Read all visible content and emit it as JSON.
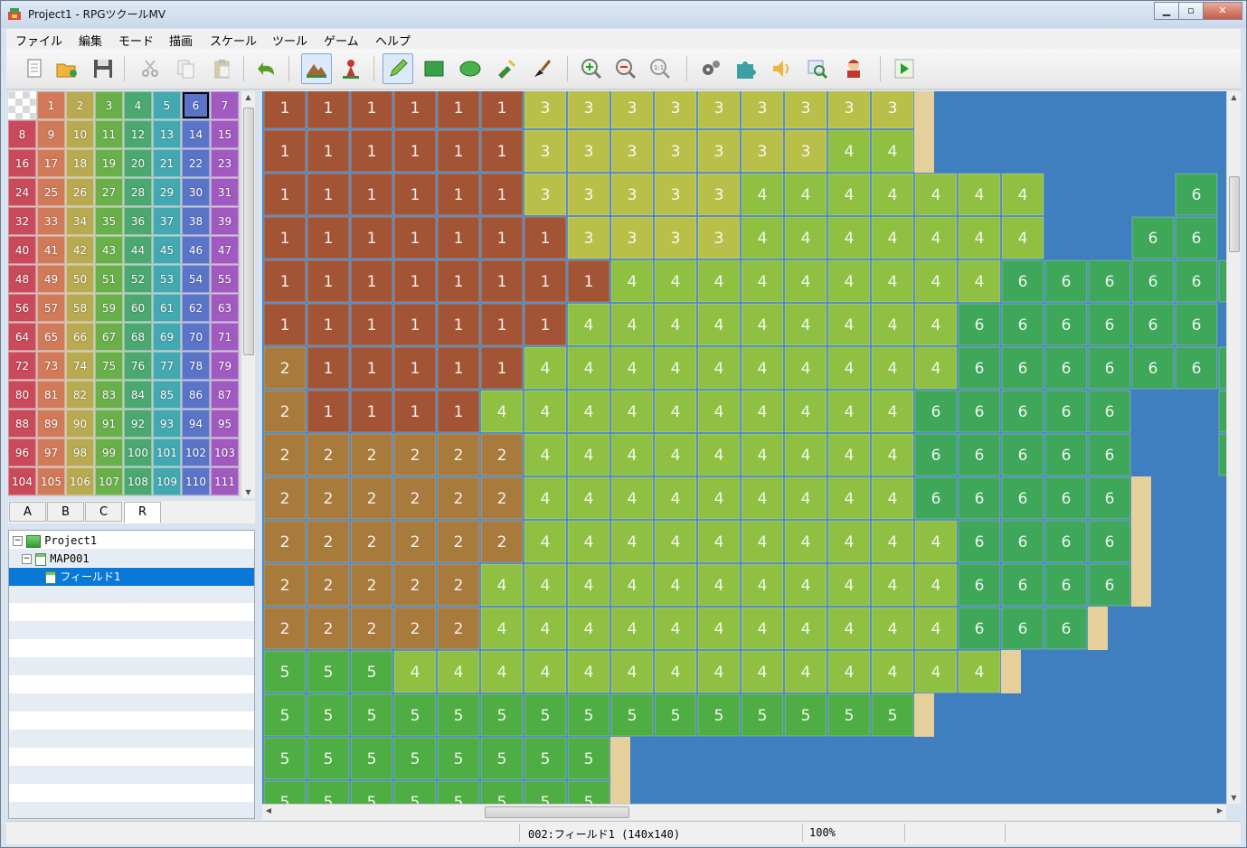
{
  "window": {
    "title": "Project1 - RPGツクールMV"
  },
  "menu": [
    "ファイル",
    "編集",
    "モード",
    "描画",
    "スケール",
    "ツール",
    "ゲーム",
    "ヘルプ"
  ],
  "toolbar": [
    {
      "name": "new-project-icon"
    },
    {
      "name": "open-project-icon"
    },
    {
      "name": "save-project-icon"
    },
    {
      "name": "cut-icon"
    },
    {
      "name": "copy-icon"
    },
    {
      "name": "paste-icon"
    },
    {
      "name": "undo-icon"
    },
    {
      "name": "map-mode-icon",
      "active": true
    },
    {
      "name": "event-mode-icon"
    },
    {
      "name": "pencil-icon",
      "active": true
    },
    {
      "name": "rectangle-icon"
    },
    {
      "name": "ellipse-icon"
    },
    {
      "name": "flood-fill-icon"
    },
    {
      "name": "shadow-pen-icon"
    },
    {
      "name": "zoom-in-icon"
    },
    {
      "name": "zoom-out-icon"
    },
    {
      "name": "actual-size-icon"
    },
    {
      "name": "database-icon"
    },
    {
      "name": "plugin-manager-icon"
    },
    {
      "name": "sound-test-icon"
    },
    {
      "name": "event-search-icon"
    },
    {
      "name": "character-generator-icon"
    },
    {
      "name": "playtest-icon"
    }
  ],
  "palette": {
    "selected": 6,
    "rows": [
      [
        "",
        "1",
        "2",
        "3",
        "4",
        "5",
        "6",
        "7"
      ],
      [
        "8",
        "9",
        "10",
        "11",
        "12",
        "13",
        "14",
        "15"
      ],
      [
        "16",
        "17",
        "18",
        "19",
        "20",
        "21",
        "22",
        "23"
      ],
      [
        "24",
        "25",
        "26",
        "27",
        "28",
        "29",
        "30",
        "31"
      ],
      [
        "32",
        "33",
        "34",
        "35",
        "36",
        "37",
        "38",
        "39"
      ],
      [
        "40",
        "41",
        "42",
        "43",
        "44",
        "45",
        "46",
        "47"
      ],
      [
        "48",
        "49",
        "50",
        "51",
        "52",
        "53",
        "54",
        "55"
      ],
      [
        "56",
        "57",
        "58",
        "59",
        "60",
        "61",
        "62",
        "63"
      ],
      [
        "64",
        "65",
        "66",
        "67",
        "68",
        "69",
        "70",
        "71"
      ],
      [
        "72",
        "73",
        "74",
        "75",
        "76",
        "77",
        "78",
        "79"
      ],
      [
        "80",
        "81",
        "82",
        "83",
        "84",
        "85",
        "86",
        "87"
      ],
      [
        "88",
        "89",
        "90",
        "91",
        "92",
        "93",
        "94",
        "95"
      ],
      [
        "96",
        "97",
        "98",
        "99",
        "100",
        "101",
        "102",
        "103"
      ],
      [
        "104",
        "105",
        "106",
        "107",
        "108",
        "109",
        "110",
        "111"
      ]
    ]
  },
  "tabs": [
    "A",
    "B",
    "C",
    "R"
  ],
  "active_tab": "R",
  "tree": {
    "project": "Project1",
    "map": "MAP001",
    "child": "フィールド1"
  },
  "map_regions": [
    "1111113333333330",
    "1111113333333440",
    "1111113333344444440006",
    "1111111333344444440066",
    "11111111444444444666666",
    "111111144444444466666606",
    "2111114444444444666666606",
    "21111444444444466666006",
    "22222244444444466666006",
    "222222444444444666660",
    "222222444444444466660",
    "22222444444444446666",
    "22222444444444446660",
    "555444444444444440",
    "555555555555555",
    "55555555",
    "55555555"
  ],
  "status": {
    "map_info": "002:フィールド1 (140x140)",
    "zoom": "100%"
  },
  "colors": {
    "region1": "#a35435",
    "region2": "#a87a3c",
    "region3": "#b9c04a",
    "region4": "#8fc042",
    "region5": "#4fae43",
    "region6": "#3ea75a",
    "water": "#3f7fbf",
    "sand": "#e5cf9a",
    "selection": "#0a78d7"
  }
}
